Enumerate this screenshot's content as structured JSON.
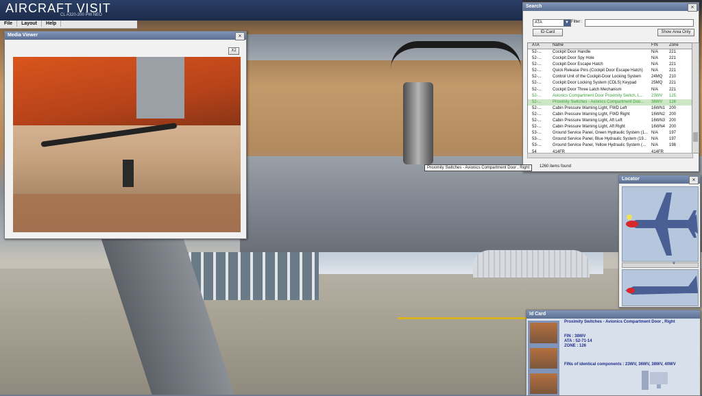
{
  "app": {
    "title": "AIRCRAFT VISIT",
    "subtitle": "CL A320-200 PW NEO"
  },
  "menu": {
    "items": [
      "File",
      "Layout",
      "Help"
    ]
  },
  "media_viewer": {
    "title": "Media Viewer",
    "close_label": "×",
    "zoom_label": "X2"
  },
  "search": {
    "title": "Search",
    "close_label": "×",
    "mode_value": "ATA",
    "filter_label": "Filter :",
    "filter_value": "",
    "id_card_button": "ID-Card",
    "show_area_button": "Show Area Only",
    "columns": [
      "ATA",
      "Name",
      "FIN",
      "Zone"
    ],
    "rows": [
      {
        "ata": "52-...",
        "name": "Cockpit Door Handle",
        "fin": "N/A",
        "zone": "221"
      },
      {
        "ata": "52-...",
        "name": "Cockpit Door Spy Hole",
        "fin": "N/A",
        "zone": "221"
      },
      {
        "ata": "52-...",
        "name": "Cockpit Door Escape Hatch",
        "fin": "N/A",
        "zone": "221"
      },
      {
        "ata": "52-...",
        "name": "Quick Release Pins (Cockpit Door Escape Hatch)",
        "fin": "N/A",
        "zone": "221"
      },
      {
        "ata": "52-...",
        "name": "Control Unit of the Cockpit-Door Locking System",
        "fin": "24MQ",
        "zone": "210"
      },
      {
        "ata": "52-...",
        "name": "Cockpit Door Locking System (CDLS) Keypad",
        "fin": "25MQ",
        "zone": "221"
      },
      {
        "ata": "52-...",
        "name": "Cockpit Door Three Latch Mechanism",
        "fin": "N/A",
        "zone": "221"
      },
      {
        "ata": "52-...",
        "name": "Avionics Compartment Door Proximity Switch, L...",
        "fin": "23WV",
        "zone": "125"
      },
      {
        "ata": "52-...",
        "name": "Proximity Switches - Avionics Compartment Doo...",
        "fin": "38WV",
        "zone": "126"
      },
      {
        "ata": "52-...",
        "name": "Cabin Pressure Warning Light, FWD Left",
        "fin": "16WN1",
        "zone": "200"
      },
      {
        "ata": "52-...",
        "name": "Cabin Pressure Warning Light, FWD Right",
        "fin": "16WN2",
        "zone": "200"
      },
      {
        "ata": "52-...",
        "name": "Cabin Pressure Warning Light, Aft Left",
        "fin": "16WN3",
        "zone": "200"
      },
      {
        "ata": "52-...",
        "name": "Cabin Pressure Warning Light, Aft Right",
        "fin": "16WN4",
        "zone": "200"
      },
      {
        "ata": "53-...",
        "name": "Ground Service Panel, Green Hydraulic System (1...",
        "fin": "N/A",
        "zone": "197"
      },
      {
        "ata": "53-...",
        "name": "Ground Service Panel, Blue Hydraulic System (19...",
        "fin": "N/A",
        "zone": "197"
      },
      {
        "ata": "53-...",
        "name": "Ground Service Panel, Yellow Hydraulic System (...",
        "fin": "N/A",
        "zone": "198"
      },
      {
        "ata": "54",
        "name": "414FR",
        "fin": "414FR",
        "zone": ""
      }
    ],
    "found_text": "1260 items found",
    "tooltip": "Proximity Switches - Avionics Compartment Door , Right"
  },
  "locator": {
    "title": "Locator",
    "close_label": "×"
  },
  "id_card": {
    "title": "Id Card",
    "name": "Proximity Switches - Avionics Compartment Door , Right",
    "fin": "FIN : 38WV",
    "ata": "ATA : 52-71-14",
    "zone": "ZONE : 126",
    "identical": "FINs of identical components : 23WV, 36WV, 38WV, 40WV"
  },
  "colors": {
    "title_bar": "#5b6f92",
    "highlight_text": "#3aa03a",
    "id_text": "#1e2c8a"
  }
}
